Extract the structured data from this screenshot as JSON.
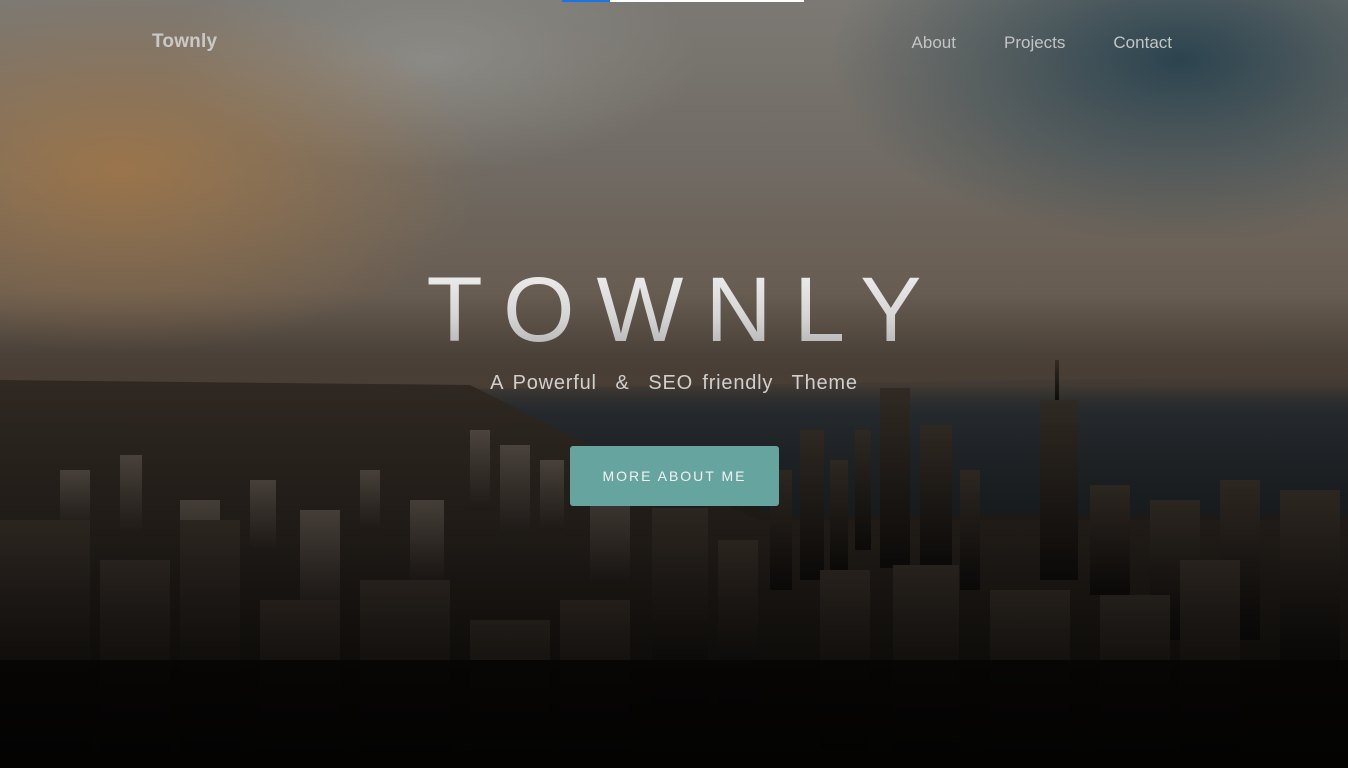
{
  "page_progress": {
    "fraction": 0.2
  },
  "header": {
    "brand": "Townly",
    "nav": [
      {
        "label": "About"
      },
      {
        "label": "Projects"
      },
      {
        "label": "Contact"
      }
    ]
  },
  "hero": {
    "title": "TOWNLY",
    "tagline": "A Powerful  &  SEO friendly  Theme",
    "cta_label": "MORE ABOUT ME",
    "background": "aerial-city-skyline-photo"
  },
  "colors": {
    "accent": "#66a59f",
    "progress": "#1a73e8",
    "nav_text": "#c4c4c4"
  }
}
